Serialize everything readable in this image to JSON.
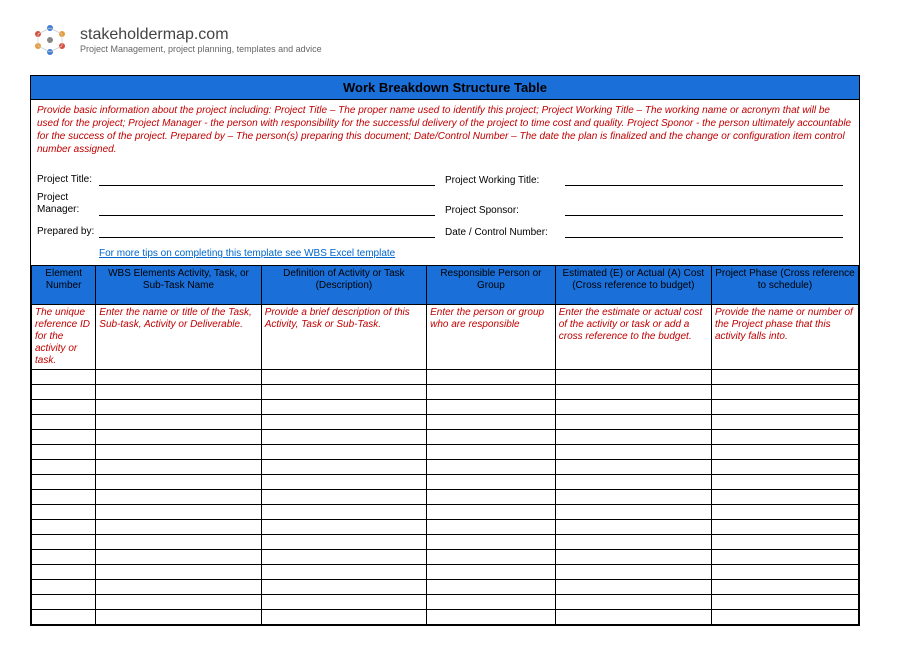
{
  "brand": {
    "name": "stakeholdermap.com",
    "tagline": "Project Management, project planning, templates and advice"
  },
  "title": "Work Breakdown Structure Table",
  "instructions": "Provide basic information about the project including: Project Title – The proper name used to identify this project; Project Working Title – The working name or acronym that will be used for the project; Project Manager - the person with responsibility for the successful delivery of the project to time cost and quality. Project Sponor - the person ultimately accountable for the success of the project. Prepared by – The person(s) preparing this document; Date/Control Number – The date the plan is finalized and the change or configuration item control number assigned.",
  "form": {
    "project_title_label": "Project Title:",
    "working_title_label": "Project Working Title:",
    "project_manager_label": "Project Manager:",
    "project_sponsor_label": "Project Sponsor:",
    "prepared_by_label": "Prepared by:",
    "date_control_label": "Date / Control Number:"
  },
  "tips_link": "For more tips on completing this template see WBS Excel template",
  "columns": [
    "Element Number",
    "WBS Elements\nActivity, Task, or Sub-Task Name",
    "Definition of Activity or Task (Description)",
    "Responsible Person or Group",
    "Estimated (E) or Actual (A) Cost (Cross reference to budget)",
    "Project Phase (Cross reference to schedule)"
  ],
  "helper_text": [
    "The unique reference ID for the activity or task.",
    "Enter the name or title of the Task, Sub-task, Activity or Deliverable.",
    "Provide a brief description of this Activity, Task or Sub-Task.",
    "Enter the person or group who are responsible",
    "Enter the estimate or actual cost of the activity or task or add a cross reference to the budget.",
    "Provide the name or number of the Project phase that this activity falls into."
  ],
  "empty_rows": 17
}
